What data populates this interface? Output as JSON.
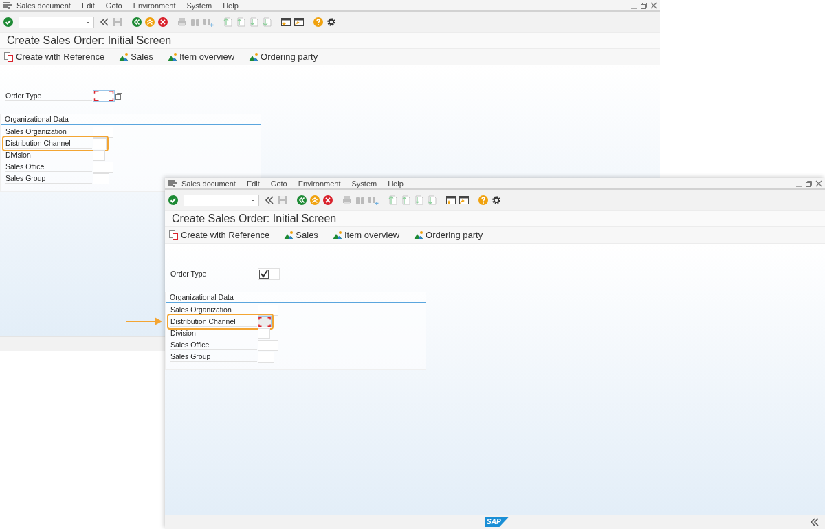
{
  "windows": [
    {
      "menu": [
        {
          "label": "Sales document"
        },
        {
          "label": "Edit"
        },
        {
          "label": "Goto"
        },
        {
          "label": "Environment"
        },
        {
          "label": "System"
        },
        {
          "label": "Help"
        }
      ],
      "title": "Create Sales Order: Initial Screen",
      "app_toolbar": [
        {
          "label": "Create with Reference",
          "kind": "reference"
        },
        {
          "label": "Sales",
          "kind": "overview"
        },
        {
          "label": "Item overview",
          "kind": "overview"
        },
        {
          "label": "Ordering party",
          "kind": "overview"
        }
      ],
      "order_type": {
        "label": "Order Type",
        "focused": true,
        "checked": false,
        "value_help": true
      },
      "org_data": {
        "title": "Organizational Data",
        "fields": [
          {
            "label": "Sales Organization",
            "highlighted": false,
            "focused": false
          },
          {
            "label": "Distribution Channel",
            "highlighted": true,
            "focused": false
          },
          {
            "label": "Division",
            "highlighted": false,
            "focused": false
          },
          {
            "label": "Sales Office",
            "highlighted": false,
            "focused": false
          },
          {
            "label": "Sales Group",
            "highlighted": false,
            "focused": false
          }
        ]
      }
    },
    {
      "menu": [
        {
          "label": "Sales document"
        },
        {
          "label": "Edit"
        },
        {
          "label": "Goto"
        },
        {
          "label": "Environment"
        },
        {
          "label": "System"
        },
        {
          "label": "Help"
        }
      ],
      "title": "Create Sales Order: Initial Screen",
      "app_toolbar": [
        {
          "label": "Create with Reference",
          "kind": "reference"
        },
        {
          "label": "Sales",
          "kind": "overview"
        },
        {
          "label": "Item overview",
          "kind": "overview"
        },
        {
          "label": "Ordering party",
          "kind": "overview"
        }
      ],
      "order_type": {
        "label": "Order Type",
        "focused": false,
        "checked": true,
        "value_help": false
      },
      "org_data": {
        "title": "Organizational Data",
        "fields": [
          {
            "label": "Sales Organization",
            "highlighted": false,
            "focused": false
          },
          {
            "label": "Distribution Channel",
            "highlighted": true,
            "focused": true
          },
          {
            "label": "Division",
            "highlighted": false,
            "focused": false
          },
          {
            "label": "Sales Office",
            "highlighted": false,
            "focused": false
          },
          {
            "label": "Sales Group",
            "highlighted": false,
            "focused": false
          }
        ]
      },
      "status_bar": {
        "logo": "SAP"
      }
    }
  ]
}
